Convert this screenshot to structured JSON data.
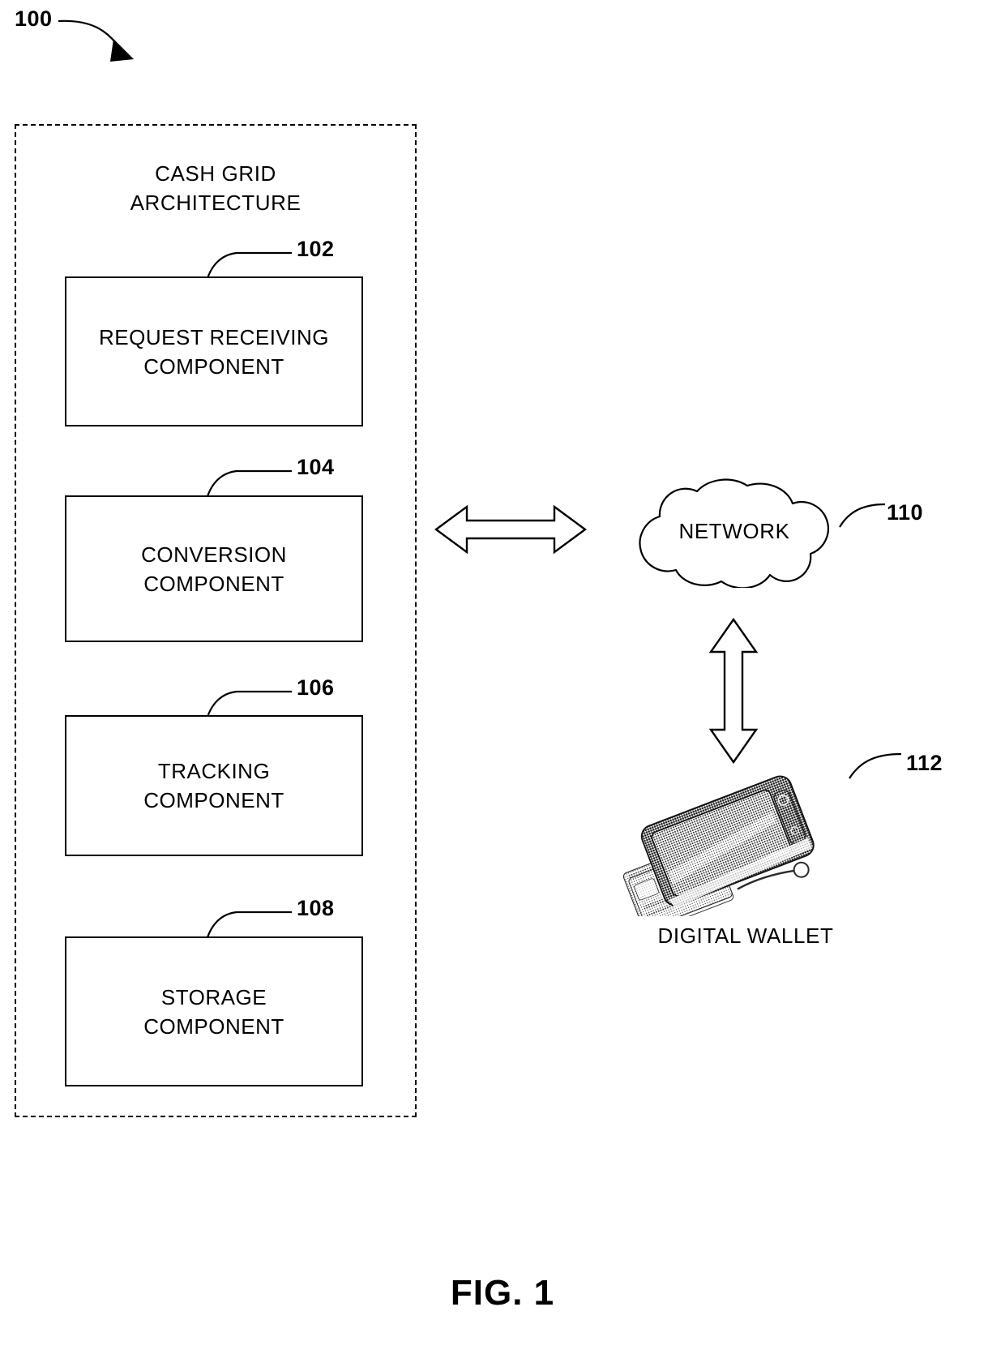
{
  "figure": {
    "caption": "FIG. 1",
    "system_ref": "100"
  },
  "system": {
    "title_line1": "CASH GRID",
    "title_line2": "ARCHITECTURE",
    "boundary_style": "dashed"
  },
  "components": [
    {
      "ref": "102",
      "label_line1": "REQUEST RECEIVING",
      "label_line2": "COMPONENT"
    },
    {
      "ref": "104",
      "label_line1": "CONVERSION",
      "label_line2": "COMPONENT"
    },
    {
      "ref": "106",
      "label_line1": "TRACKING",
      "label_line2": "COMPONENT"
    },
    {
      "ref": "108",
      "label_line1": "STORAGE",
      "label_line2": "COMPONENT"
    }
  ],
  "network": {
    "ref": "110",
    "label": "NETWORK",
    "shape": "cloud-icon"
  },
  "wallet": {
    "ref": "112",
    "caption": "DIGITAL WALLET",
    "image": "smartphone-with-credit-card-photo"
  },
  "connectors": {
    "architecture_to_network": "bidirectional-horizontal-arrow-icon",
    "network_to_wallet": "bidirectional-vertical-arrow-icon",
    "system_pointer": "curved-arrow-icon"
  },
  "colors": {
    "ink": "#000000",
    "paper": "#ffffff"
  }
}
